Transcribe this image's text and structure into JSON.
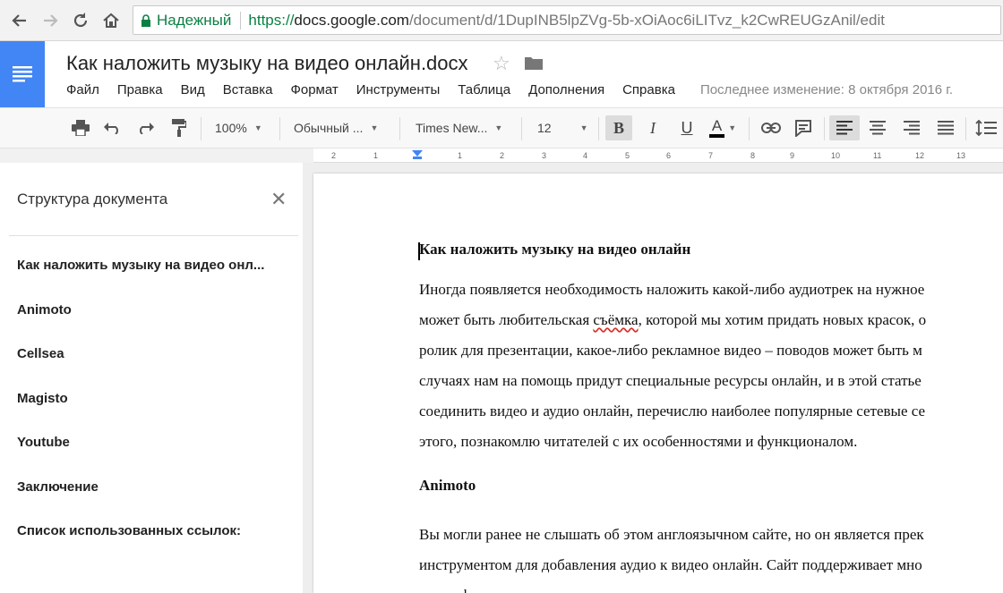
{
  "browser": {
    "secure_label": "Надежный",
    "url_scheme": "https://",
    "url_host": "docs.google.com",
    "url_path": "/document/d/1DupINB5lpZVg-5b-xOiAoc6iLITvz_k2CwREUGzAnil/edit"
  },
  "doc": {
    "title": "Как наложить музыку на видео онлайн.docx",
    "menu": [
      "Файл",
      "Правка",
      "Вид",
      "Вставка",
      "Формат",
      "Инструменты",
      "Таблица",
      "Дополнения",
      "Справка"
    ],
    "last_edit": "Последнее изменение: 8 октября 2016 г."
  },
  "toolbar": {
    "zoom": "100%",
    "style": "Обычный ...",
    "font": "Times New...",
    "size": "12",
    "bold": "B",
    "italic": "I",
    "underline": "U",
    "text_color": "A"
  },
  "ruler": {
    "ticks": [
      "2",
      "1",
      "1",
      "2",
      "3",
      "4",
      "5",
      "6",
      "7",
      "8",
      "9",
      "10",
      "11",
      "12",
      "13"
    ]
  },
  "sidebar": {
    "title": "Структура документа",
    "close": "✕",
    "items": [
      "Как наложить музыку на видео онл...",
      "Animoto",
      "Cellsea",
      "Magisto",
      "Youtube",
      "Заключение",
      "Список использованных ссылок:"
    ]
  },
  "content": {
    "heading1": "Как наложить музыку на видео онлайн",
    "para1": {
      "line1": "Иногда появляется необходимость наложить какой-либо аудиотрек на нужное",
      "line2_before": "может быть любительская ",
      "line2_spell": "съёмка",
      "line2_after": ", которой мы хотим придать новых красок, о",
      "line3": "ролик для презентации, какое-либо рекламное видео – поводов может быть м",
      "line4": "случаях нам на помощь придут специальные ресурсы онлайн, и в этой статье",
      "line5": "соединить видео и аудио онлайн, перечислю наиболее популярные сетевые се",
      "line6": "этого, познакомлю читателей с их особенностями и функционалом."
    },
    "heading2": "Animoto",
    "para2": {
      "line1": "Вы могли ранее не слышать об этом англоязычном сайте, но он является прек",
      "line2": "инструментом для добавления аудио к видео онлайн. Сайт поддерживает мно",
      "line3": "видео форматов, и позволит вам легко соединить воедино ваши видео и аудио"
    }
  },
  "colors": {
    "docs_blue": "#4285f4",
    "secure_green": "#0b8043"
  }
}
